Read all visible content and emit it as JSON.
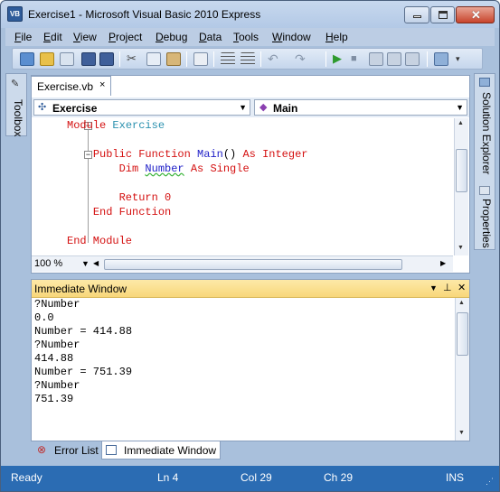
{
  "window": {
    "title": "Exercise1 - Microsoft Visual Basic 2010 Express",
    "app_icon_text": "VB"
  },
  "menu": [
    {
      "label": "File",
      "accel": "F",
      "rest": "ile"
    },
    {
      "label": "Edit",
      "accel": "E",
      "rest": "dit"
    },
    {
      "label": "View",
      "accel": "V",
      "rest": "iew"
    },
    {
      "label": "Project",
      "accel": "P",
      "rest": "roject"
    },
    {
      "label": "Debug",
      "accel": "D",
      "rest": "ebug"
    },
    {
      "label": "Data",
      "accel": "D",
      "rest": "ata"
    },
    {
      "label": "Tools",
      "accel": "T",
      "rest": "ools"
    },
    {
      "label": "Window",
      "accel": "W",
      "rest": "indow"
    },
    {
      "label": "Help",
      "accel": "H",
      "rest": "elp"
    }
  ],
  "side_panels": {
    "left": "Toolbox",
    "right_top": "Solution Explorer",
    "right_bottom": "Properties"
  },
  "editor": {
    "tab_label": "Exercise.vb",
    "tab_close": "×",
    "class_combo": "Exercise",
    "method_combo": "Main",
    "zoom": "100 %",
    "code": {
      "l1_kw": "Module",
      "l1_name": "Exercise",
      "l2_kw1": "Public Function",
      "l2_fn": "Main",
      "l2_paren": "()",
      "l2_kw2": "As",
      "l2_type": "Integer",
      "l3_kw1": "Dim",
      "l3_var": "Number",
      "l3_kw2": "As",
      "l3_type": "Single",
      "l4_kw": "Return",
      "l4_val": "0",
      "l5_kw": "End Function",
      "l6_kw": "End Module"
    }
  },
  "immediate": {
    "title": "Immediate Window",
    "lines": [
      "?Number",
      "0.0",
      "Number = 414.88",
      "?Number",
      "414.88",
      "Number = 751.39",
      "?Number",
      "751.39"
    ]
  },
  "bottom_tabs": {
    "error_list": "Error List",
    "immediate": "Immediate Window"
  },
  "status": {
    "state": "Ready",
    "line": "Ln 4",
    "col": "Col 29",
    "ch": "Ch 29",
    "mode": "INS"
  },
  "colors": {
    "status_bar": "#2b6cb3",
    "keyword": "#d41010",
    "type_name": "#2b91af"
  }
}
